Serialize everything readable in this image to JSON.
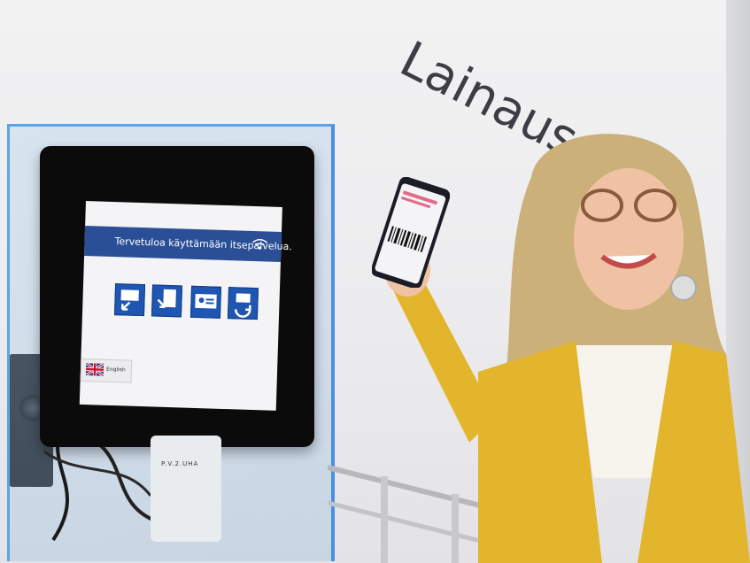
{
  "wall_sign": {
    "text": "Lainaus"
  },
  "kiosk": {
    "welcome_text": "Tervetuloa käyttämään itsepalvelua.",
    "language_button": "English",
    "icons": [
      {
        "name": "lend-icon"
      },
      {
        "name": "return-icon"
      },
      {
        "name": "account-icon"
      },
      {
        "name": "renew-icon"
      }
    ]
  },
  "card_reader": {
    "label": "P.V.2.UHA"
  },
  "colors": {
    "kiosk_header": "#2a4f96",
    "kiosk_icon": "#1f56b2",
    "cardigan": "#e2b52c",
    "glass_edge": "#5aa4ea"
  }
}
